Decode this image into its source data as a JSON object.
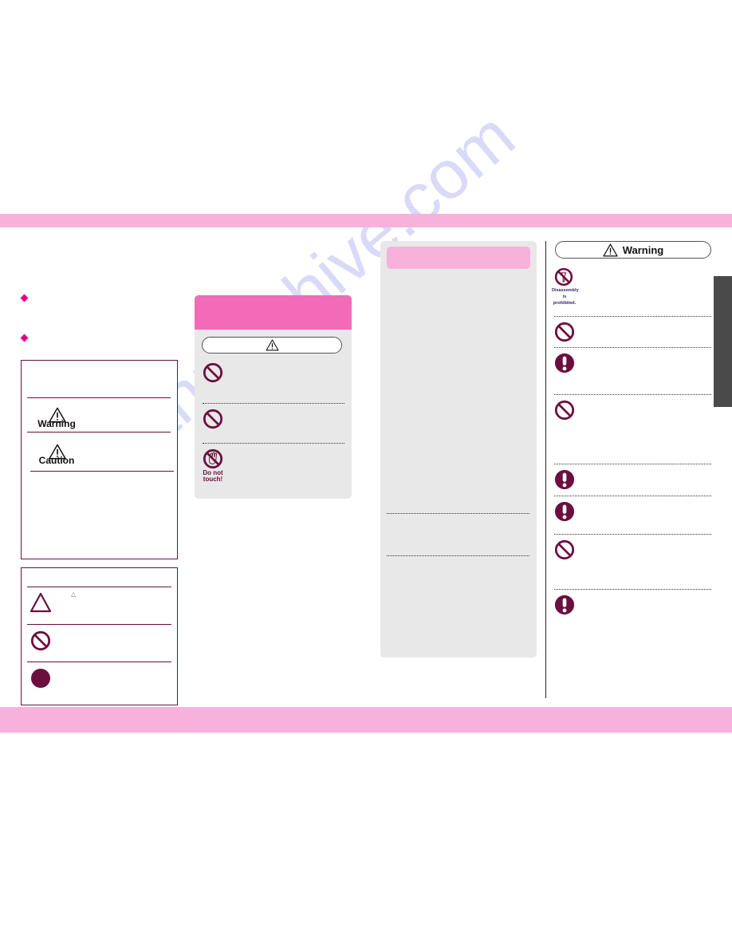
{
  "page": {
    "colors": {
      "band_pink": "#f8b1da",
      "header_pink": "#f36bb8",
      "bullet_magenta": "#e4007f",
      "symbol_maroon": "#6b0f3e",
      "panel_gray": "#e8e8e8",
      "side_tab_gray": "#4a4a4a"
    },
    "watermark": "manualshive.com"
  },
  "left_column": {
    "bullets": [
      "diamond-bullet",
      "diamond-bullet"
    ],
    "legend_box": {
      "rows": [
        {
          "icon": "warning-triangle-icon",
          "label": "Warning"
        },
        {
          "icon": "caution-triangle-icon",
          "label": "Caution"
        }
      ]
    },
    "symbol_box": {
      "rows": [
        {
          "icon": "attention-triangle-icon",
          "inline_glyph": "△"
        },
        {
          "icon": "prohibited-icon"
        },
        {
          "icon": "mandatory-dot-icon"
        }
      ]
    }
  },
  "middle_panel": {
    "pill_icon": "warning-triangle-icon",
    "items": [
      {
        "icon": "prohibited-icon"
      },
      {
        "icon": "prohibited-icon"
      },
      {
        "icon": "do-not-touch-icon",
        "caption": "Do not touch!"
      }
    ]
  },
  "gray_panel": {
    "header": "pink-header"
  },
  "right_column": {
    "pill_label": "Warning",
    "pill_icon": "warning-triangle-icon",
    "items": [
      {
        "icon": "disassembly-prohibited-icon",
        "caption": "Disassembly is prohibited."
      },
      {
        "icon": "prohibited-icon"
      },
      {
        "icon": "mandatory-icon"
      },
      {
        "icon": "prohibited-icon"
      },
      {
        "icon": "mandatory-icon"
      },
      {
        "icon": "mandatory-icon"
      },
      {
        "icon": "prohibited-icon"
      },
      {
        "icon": "mandatory-icon"
      }
    ]
  }
}
